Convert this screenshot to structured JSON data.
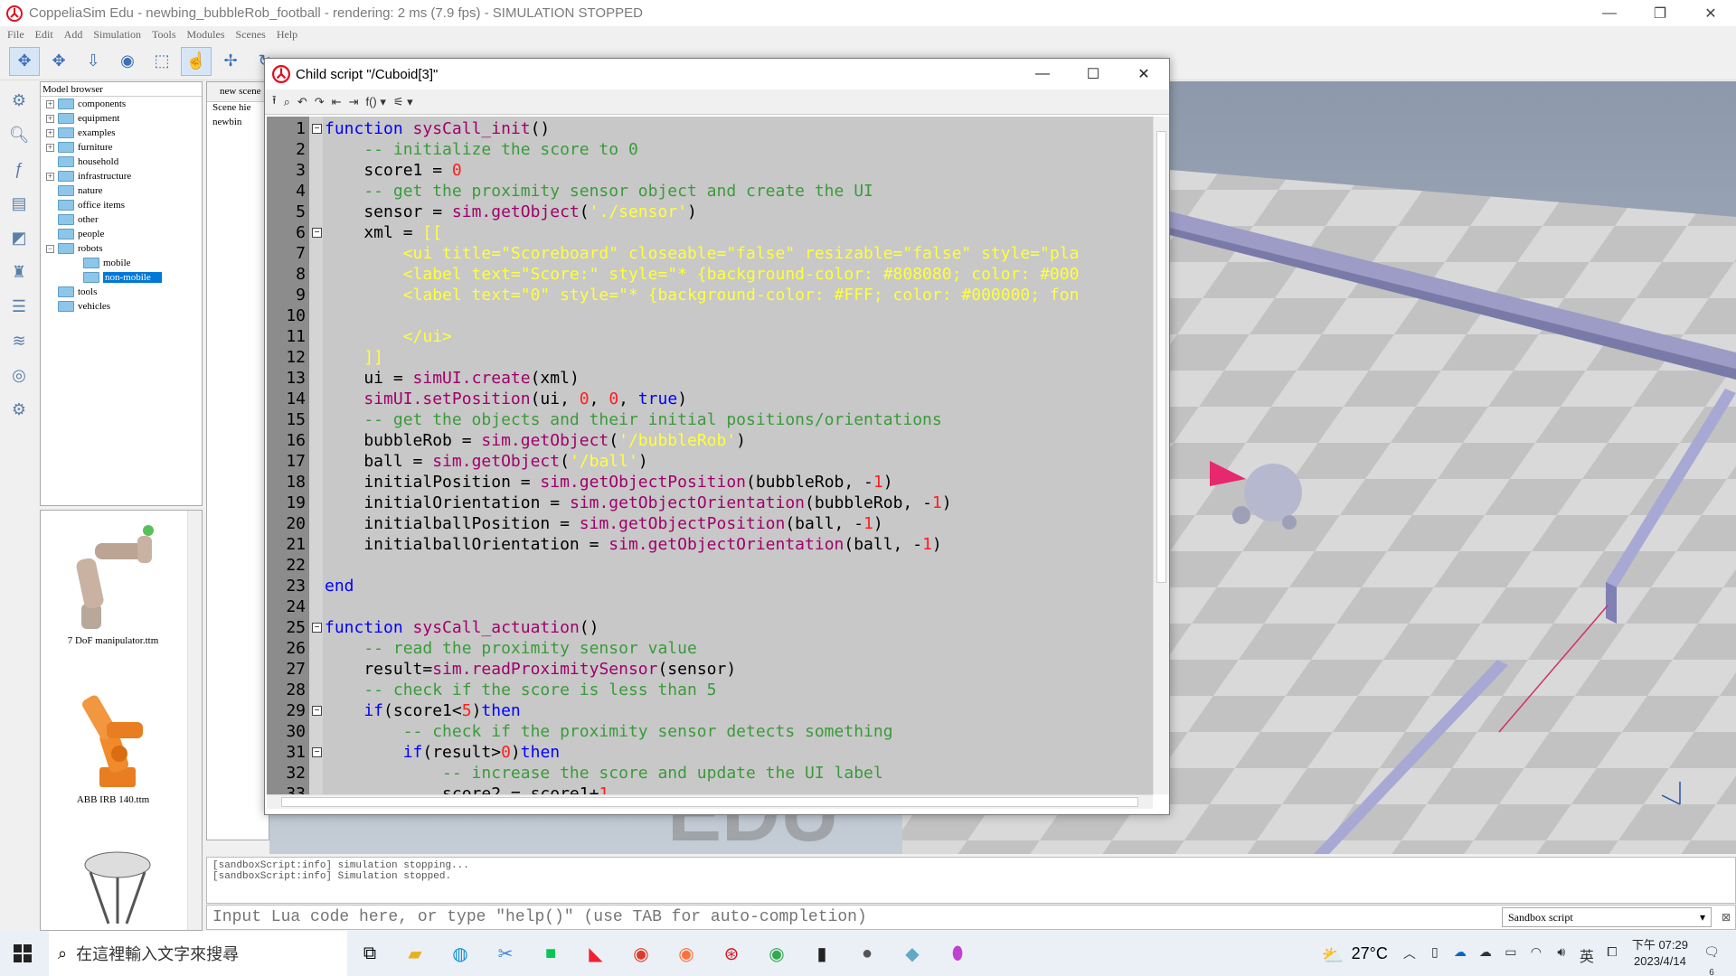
{
  "app": {
    "title": "CoppeliaSim Edu - newbing_bubbleRob_football - rendering: 2 ms (7.9 fps) - SIMULATION STOPPED"
  },
  "menu": [
    "File",
    "Edit",
    "Add",
    "Simulation",
    "Tools",
    "Modules",
    "Scenes",
    "Help"
  ],
  "model_browser": {
    "header": "Model browser",
    "items": [
      {
        "label": "components",
        "expand": "+"
      },
      {
        "label": "equipment",
        "expand": "+"
      },
      {
        "label": "examples",
        "expand": "+"
      },
      {
        "label": "furniture",
        "expand": "+"
      },
      {
        "label": "household",
        "expand": ""
      },
      {
        "label": "infrastructure",
        "expand": "+"
      },
      {
        "label": "nature",
        "expand": ""
      },
      {
        "label": "office items",
        "expand": ""
      },
      {
        "label": "other",
        "expand": ""
      },
      {
        "label": "people",
        "expand": ""
      },
      {
        "label": "robots",
        "expand": "−"
      },
      {
        "label": "mobile",
        "expand": "",
        "indent": true
      },
      {
        "label": "non-mobile",
        "expand": "",
        "indent": true,
        "selected": true
      },
      {
        "label": "tools",
        "expand": ""
      },
      {
        "label": "vehicles",
        "expand": ""
      }
    ],
    "thumbnails": [
      "7 DoF manipulator.ttm",
      "ABB IRB 140.ttm"
    ]
  },
  "scene_hierarchy": {
    "tab": "new scene",
    "header": "Scene hie",
    "root": "newbin"
  },
  "script_window": {
    "title": "Child script \"/Cuboid[3]\"",
    "lines": [
      {
        "n": "1",
        "fold": "−",
        "t": [
          [
            "k",
            "function "
          ],
          [
            "f",
            "sysCall_init"
          ],
          [
            "",
            "()"
          ]
        ]
      },
      {
        "n": "2",
        "t": [
          [
            "c",
            "    -- initialize the score to 0"
          ]
        ]
      },
      {
        "n": "3",
        "t": [
          [
            "",
            "    score1 = "
          ],
          [
            "n",
            "0"
          ]
        ]
      },
      {
        "n": "4",
        "t": [
          [
            "c",
            "    -- get the proximity sensor object and create the UI"
          ]
        ]
      },
      {
        "n": "5",
        "t": [
          [
            "",
            "    sensor = "
          ],
          [
            "f",
            "sim.getObject"
          ],
          [
            "",
            "("
          ],
          [
            "s",
            "'./sensor'"
          ],
          [
            "",
            ")"
          ]
        ]
      },
      {
        "n": "6",
        "fold": "−",
        "t": [
          [
            "",
            "    xml = "
          ],
          [
            "s",
            "[["
          ]
        ]
      },
      {
        "n": "7",
        "t": [
          [
            "s",
            "        <ui title=\"Scoreboard\" closeable=\"false\" resizable=\"false\" style=\"pla"
          ]
        ]
      },
      {
        "n": "8",
        "t": [
          [
            "s",
            "        <label text=\"Score:\" style=\"* {background-color: #808080; color: #000"
          ]
        ]
      },
      {
        "n": "9",
        "t": [
          [
            "s",
            "        <label text=\"0\" style=\"* {background-color: #FFF; color: #000000; fon"
          ]
        ]
      },
      {
        "n": "10",
        "t": []
      },
      {
        "n": "11",
        "t": [
          [
            "s",
            "        </ui>"
          ]
        ]
      },
      {
        "n": "12",
        "t": [
          [
            "s",
            "    ]]"
          ]
        ]
      },
      {
        "n": "13",
        "t": [
          [
            "",
            "    ui = "
          ],
          [
            "f",
            "simUI.create"
          ],
          [
            "",
            "(xml)"
          ]
        ]
      },
      {
        "n": "14",
        "t": [
          [
            "",
            "    "
          ],
          [
            "f",
            "simUI.setPosition"
          ],
          [
            "",
            "(ui, "
          ],
          [
            "n",
            "0"
          ],
          [
            "",
            ", "
          ],
          [
            "n",
            "0"
          ],
          [
            "",
            ", "
          ],
          [
            "k",
            "true"
          ],
          [
            "",
            ")"
          ]
        ]
      },
      {
        "n": "15",
        "t": [
          [
            "c",
            "    -- get the objects and their initial positions/orientations"
          ]
        ]
      },
      {
        "n": "16",
        "t": [
          [
            "",
            "    bubbleRob = "
          ],
          [
            "f",
            "sim.getObject"
          ],
          [
            "",
            "("
          ],
          [
            "s",
            "'/bubbleRob'"
          ],
          [
            "",
            ")"
          ]
        ]
      },
      {
        "n": "17",
        "t": [
          [
            "",
            "    ball = "
          ],
          [
            "f",
            "sim.getObject"
          ],
          [
            "",
            "("
          ],
          [
            "s",
            "'/ball'"
          ],
          [
            "",
            ")"
          ]
        ]
      },
      {
        "n": "18",
        "t": [
          [
            "",
            "    initialPosition = "
          ],
          [
            "f",
            "sim.getObjectPosition"
          ],
          [
            "",
            "(bubbleRob, -"
          ],
          [
            "n",
            "1"
          ],
          [
            "",
            ")"
          ]
        ]
      },
      {
        "n": "19",
        "t": [
          [
            "",
            "    initialOrientation = "
          ],
          [
            "f",
            "sim.getObjectOrientation"
          ],
          [
            "",
            "(bubbleRob, -"
          ],
          [
            "n",
            "1"
          ],
          [
            "",
            ")"
          ]
        ]
      },
      {
        "n": "20",
        "t": [
          [
            "",
            "    initialballPosition = "
          ],
          [
            "f",
            "sim.getObjectPosition"
          ],
          [
            "",
            "(ball, -"
          ],
          [
            "n",
            "1"
          ],
          [
            "",
            ")"
          ]
        ]
      },
      {
        "n": "21",
        "t": [
          [
            "",
            "    initialballOrientation = "
          ],
          [
            "f",
            "sim.getObjectOrientation"
          ],
          [
            "",
            "(ball, -"
          ],
          [
            "n",
            "1"
          ],
          [
            "",
            ")"
          ]
        ]
      },
      {
        "n": "22",
        "t": []
      },
      {
        "n": "23",
        "t": [
          [
            "k",
            "end"
          ]
        ]
      },
      {
        "n": "24",
        "t": []
      },
      {
        "n": "25",
        "fold": "−",
        "t": [
          [
            "k",
            "function "
          ],
          [
            "f",
            "sysCall_actuation"
          ],
          [
            "",
            "()"
          ]
        ]
      },
      {
        "n": "26",
        "t": [
          [
            "c",
            "    -- read the proximity sensor value"
          ]
        ]
      },
      {
        "n": "27",
        "t": [
          [
            "",
            "    result="
          ],
          [
            "f",
            "sim.readProximitySensor"
          ],
          [
            "",
            "(sensor)"
          ]
        ]
      },
      {
        "n": "28",
        "t": [
          [
            "c",
            "    -- check if the score is less than 5"
          ]
        ]
      },
      {
        "n": "29",
        "fold": "−",
        "t": [
          [
            "k",
            "    if"
          ],
          [
            "",
            "(score1<"
          ],
          [
            "n",
            "5"
          ],
          [
            "",
            ")"
          ],
          [
            "k",
            "then"
          ]
        ]
      },
      {
        "n": "30",
        "t": [
          [
            "c",
            "        -- check if the proximity sensor detects something"
          ]
        ]
      },
      {
        "n": "31",
        "fold": "−",
        "t": [
          [
            "k",
            "        if"
          ],
          [
            "",
            "(result>"
          ],
          [
            "n",
            "0"
          ],
          [
            "",
            ")"
          ],
          [
            "k",
            "then"
          ]
        ]
      },
      {
        "n": "32",
        "t": [
          [
            "c",
            "            -- increase the score and update the UI label"
          ]
        ]
      },
      {
        "n": "33",
        "t": [
          [
            "",
            "            score2 = score1+"
          ],
          [
            "n",
            "1"
          ]
        ]
      }
    ]
  },
  "console": {
    "lines": [
      "[sandboxScript:info] simulation stopping...",
      "[sandboxScript:info] Simulation stopped."
    ]
  },
  "lua_input": {
    "placeholder": "Input Lua code here, or type \"help()\" (use TAB for auto-completion)",
    "script_select": "Sandbox script"
  },
  "taskbar": {
    "search_placeholder": "在這裡輸入文字來搜尋",
    "temperature": "27°C",
    "ime": "英",
    "time": "下午 07:29",
    "date": "2023/4/14",
    "notifications": "6"
  },
  "colors": {
    "accent": "#0078d7",
    "comment": "#3a9b3a",
    "keyword": "#0000ff",
    "function": "#a0006b",
    "string": "#ffff3c",
    "number": "#ff1e1e",
    "editor_bg": "#c8c8c8"
  }
}
